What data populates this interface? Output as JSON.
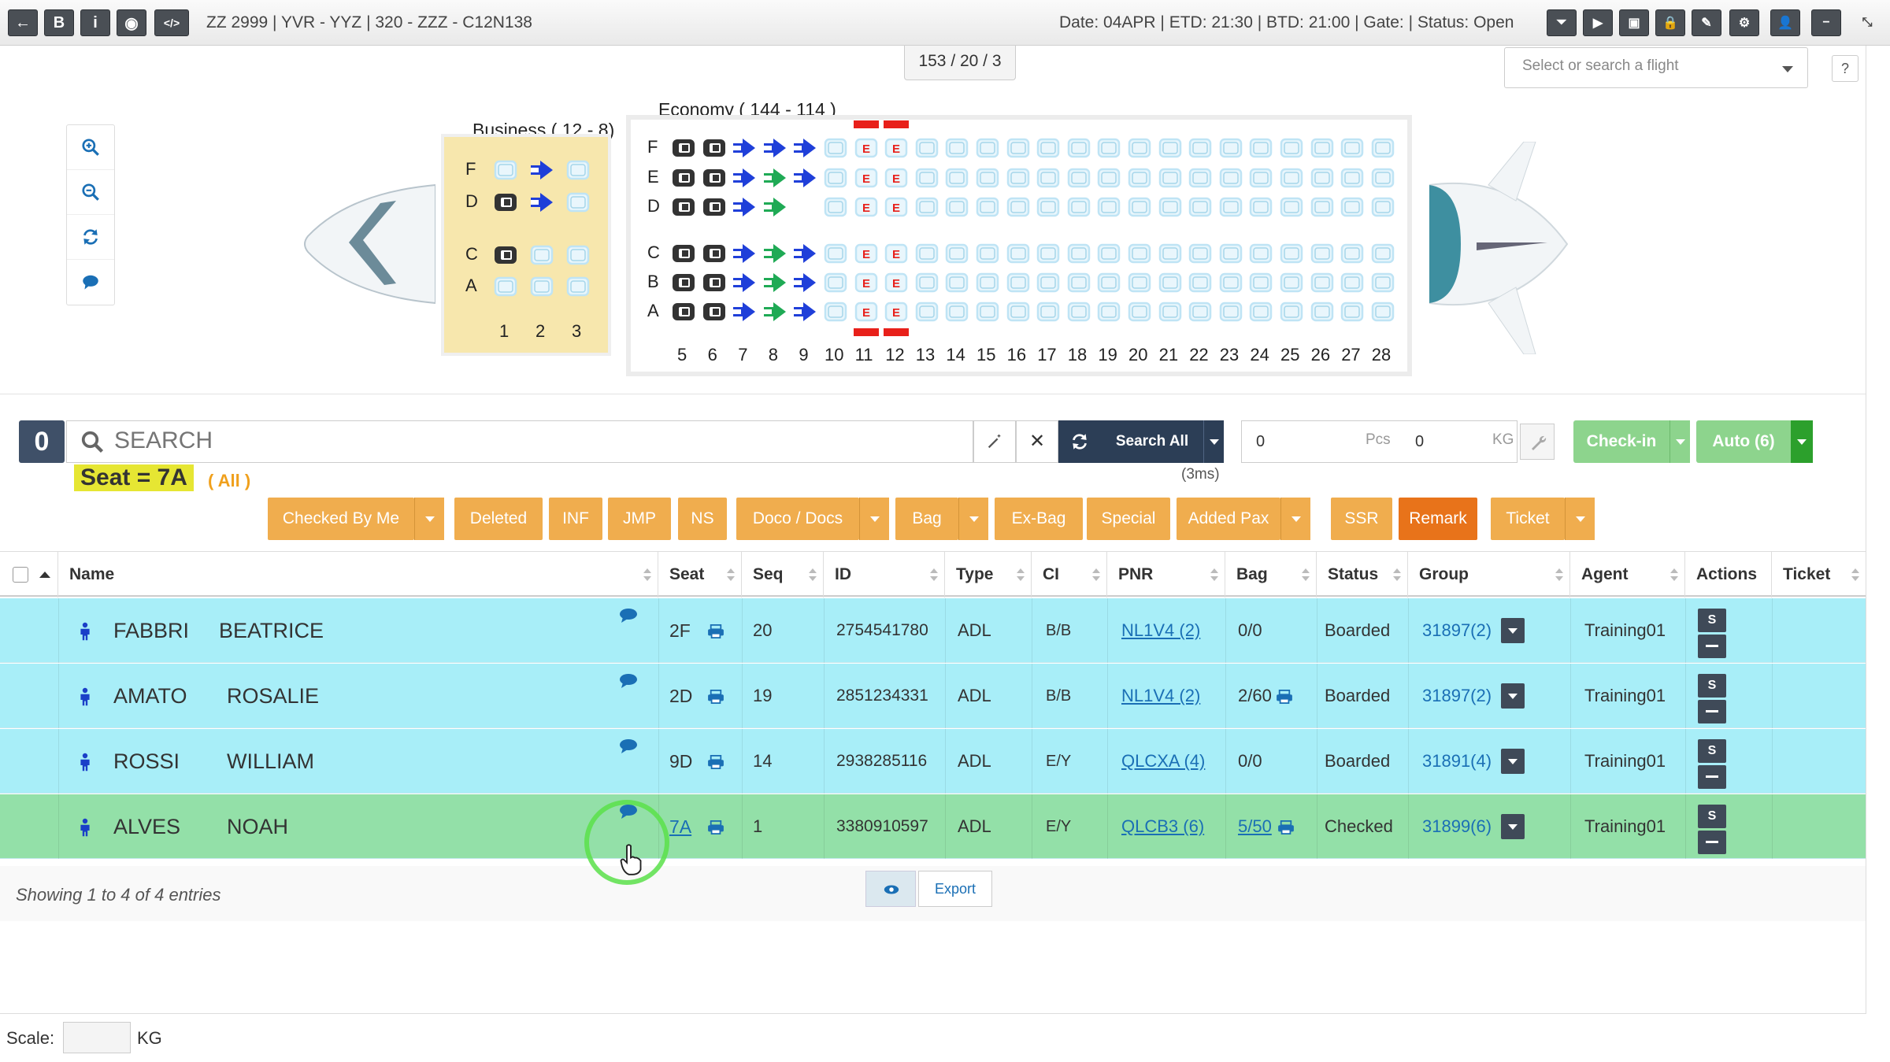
{
  "topbar": {
    "left_buttons": [
      {
        "name": "back-icon",
        "glyph": "←"
      },
      {
        "name": "bold-b-icon",
        "glyph": "B"
      },
      {
        "name": "info-icon",
        "glyph": "i"
      },
      {
        "name": "target-icon",
        "glyph": "◉"
      },
      {
        "name": "code-icon",
        "glyph": "</>"
      }
    ],
    "flight_title": "ZZ 2999 | YVR - YYZ | 320 - ZZZ - C12N138",
    "flight_status": "Date: 04APR | ETD: 21:30 | BTD: 21:00 | Gate: | Status: Open",
    "right_buttons": [
      "filter-icon",
      "play-icon",
      "briefcase-icon",
      "lock-icon",
      "wrench-icon",
      "cogs-icon",
      "add-user-icon",
      "minimize-icon",
      "collapse-icon"
    ]
  },
  "counter": "153 / 20 / 3",
  "flight_select": {
    "placeholder": "Select or search a flight"
  },
  "help": "?",
  "seatmap": {
    "business_title": "Business ( 12 - 8)",
    "economy_title": "Economy ( 144 - 114 )",
    "business_rows": [
      "F",
      "D",
      "C",
      "A"
    ],
    "business_cols": [
      "1",
      "2",
      "3"
    ],
    "economy_rows": [
      "F",
      "E",
      "D",
      "C",
      "B",
      "A"
    ],
    "economy_cols": [
      "5",
      "6",
      "7",
      "8",
      "9",
      "10",
      "11",
      "12",
      "13",
      "14",
      "15",
      "16",
      "17",
      "18",
      "19",
      "20",
      "21",
      "22",
      "23",
      "24",
      "25",
      "26",
      "27",
      "28"
    ],
    "exit_label": "E",
    "colors": {
      "business_bg": "#f7e7ad",
      "seat_free": "#bfe4f5",
      "seat_blocked": "#333333",
      "seat_boarded": "#1f3fd9",
      "seat_checked": "#1faa55",
      "exit": "#e8201a"
    }
  },
  "search": {
    "count": "0",
    "placeholder": "SEARCH",
    "search_all": "Search All",
    "timing": "(3ms)",
    "pcs_value": "0",
    "pcs_unit": "Pcs",
    "kg_value": "0",
    "kg_unit": "KG",
    "checkin": "Check-in",
    "auto": "Auto (6)",
    "filter_tag": "Seat = 7A",
    "filter_all": "( All )"
  },
  "filters": [
    {
      "label": "Checked By Me",
      "caret": true
    },
    {
      "label": "Deleted",
      "caret": false
    },
    {
      "label": "INF",
      "caret": false
    },
    {
      "label": "JMP",
      "caret": false
    },
    {
      "label": "NS",
      "caret": false
    },
    {
      "label": "Doco / Docs",
      "caret": true
    },
    {
      "label": "Bag",
      "caret": true
    },
    {
      "label": "Ex-Bag",
      "caret": false
    },
    {
      "label": "Special",
      "caret": false
    },
    {
      "label": "Added Pax",
      "caret": true
    },
    {
      "label": "SSR",
      "caret": false
    },
    {
      "label": "Remark",
      "caret": false,
      "active": true
    },
    {
      "label": "Ticket",
      "caret": true
    }
  ],
  "table": {
    "headers": [
      "Name",
      "Seat",
      "Seq",
      "ID",
      "Type",
      "CI",
      "PNR",
      "Bag",
      "Status",
      "Group",
      "Agent",
      "Actions",
      "Ticket"
    ],
    "rows": [
      {
        "last": "FABBRI",
        "first": "BEATRICE",
        "seat": "2F",
        "seq": "20",
        "id": "2754541780",
        "type": "ADL",
        "ci": "B/B",
        "pnr": "NL1V4 (2)",
        "bag": "0/0",
        "bag_link": false,
        "status": "Boarded",
        "group": "31897(2)",
        "agent": "Training01",
        "state": "boarded",
        "seat_link": false
      },
      {
        "last": "AMATO",
        "first": "ROSALIE",
        "seat": "2D",
        "seq": "19",
        "id": "2851234331",
        "type": "ADL",
        "ci": "B/B",
        "pnr": "NL1V4 (2)",
        "bag": "2/60",
        "bag_link": false,
        "bag_print": true,
        "status": "Boarded",
        "group": "31897(2)",
        "agent": "Training01",
        "state": "boarded",
        "seat_link": false
      },
      {
        "last": "ROSSI",
        "first": "WILLIAM",
        "seat": "9D",
        "seq": "14",
        "id": "2938285116",
        "type": "ADL",
        "ci": "E/Y",
        "pnr": "QLCXA (4)",
        "bag": "0/0",
        "bag_link": false,
        "status": "Boarded",
        "group": "31891(4)",
        "agent": "Training01",
        "state": "boarded",
        "seat_link": false
      },
      {
        "last": "ALVES",
        "first": "NOAH",
        "seat": "7A",
        "seq": "1",
        "id": "3380910597",
        "type": "ADL",
        "ci": "E/Y",
        "pnr": "QLCB3 (6)",
        "bag": "5/50",
        "bag_link": true,
        "bag_print": true,
        "status": "Checked",
        "group": "31899(6)",
        "agent": "Training01",
        "state": "checked",
        "seat_link": true
      }
    ],
    "action_s": "S"
  },
  "footer": {
    "info": "Showing 1 to 4 of 4 entries",
    "export": "Export",
    "scale_label": "Scale:",
    "scale_unit": "KG"
  }
}
